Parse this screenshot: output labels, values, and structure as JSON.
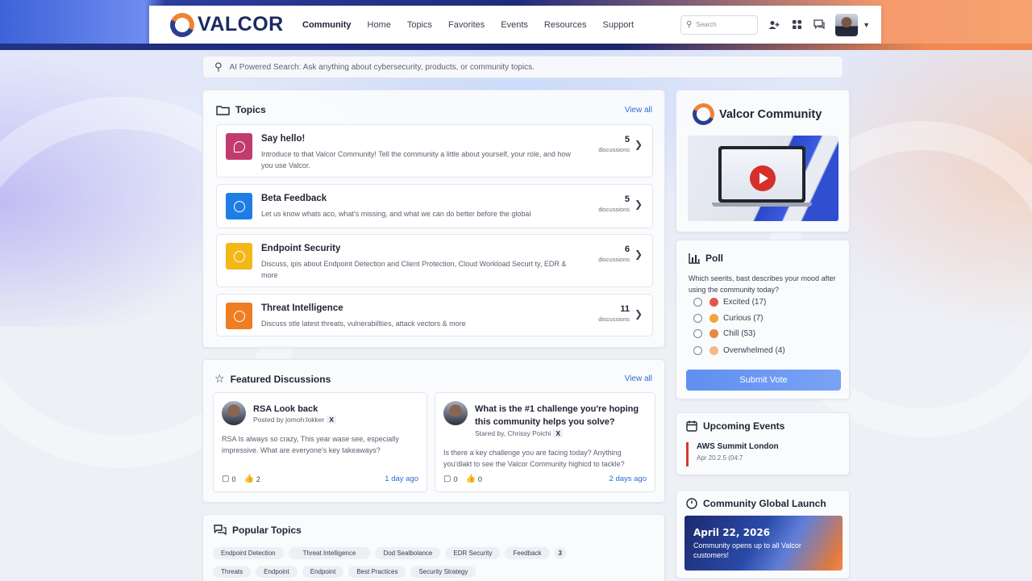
{
  "brand": {
    "name": "VALCOR"
  },
  "nav": {
    "links": [
      "Community",
      "Home",
      "Topics",
      "Favorites",
      "Events",
      "Resources",
      "Support"
    ],
    "active": "Community",
    "search_placeholder": "Search"
  },
  "ai_search": {
    "placeholder": "AI Powered Search: Ask anything about cybersecurity, products, or community topics."
  },
  "topics": {
    "title": "Topics",
    "view_all": "View all",
    "items": [
      {
        "title": "Say hello!",
        "desc": "Introduce to that Valcor Community! Tell the community a little about yourself, your role, and how you use Valcor.",
        "count": "5",
        "count_label": "discussions",
        "color": "#c23b6e"
      },
      {
        "title": "Beta Feedback",
        "desc": "Let us know whats aco, what's missing, and what we can do better before the global",
        "count": "5",
        "count_label": "discussions",
        "color": "#1f7ee6"
      },
      {
        "title": "Endpoint Security",
        "desc": "Discuss, ipis about Endpoint Detection and Client Protection, Cloud Workload Securt ty, EDR & more",
        "count": "6",
        "count_label": "discussions",
        "color": "#f4b71a"
      },
      {
        "title": "Threat Intelligence",
        "desc": "Discuss stle latest threats, vulnerabillties, attack vectors & more",
        "count": "11",
        "count_label": "discussions",
        "color": "#ef7d22"
      }
    ]
  },
  "featured": {
    "title": "Featured Discussions",
    "view_all": "View all",
    "items": [
      {
        "title": "RSA Look back",
        "by": "Posted by jomoh:lokker",
        "badge": "X",
        "text": "RSA Is always so crazy, This year wase see, especially impressive. What are everyone's key takeaways?",
        "comments": "0",
        "likes": "2",
        "ago": "1 day ago"
      },
      {
        "title": "What is the #1 challenge you're hoping this community helps you solve?",
        "by": "Stared by, Chrissy Poichi",
        "badge": "X",
        "text": "Is there a key challenge you are facing today? Anything you'dlakt to see the Valcor Community highicd to tackle?",
        "comments": "0",
        "likes": "0",
        "ago": "2 days ago"
      }
    ]
  },
  "popular": {
    "title": "Popular Topics",
    "row1": [
      "Endpoint Detection",
      "Threat Intelligence",
      "Dod Sealbolance",
      "EDR Security",
      "Feedback",
      "3"
    ],
    "row2": [
      "Threats",
      "Endpoint",
      "Endpoint",
      "Best Practices",
      "Security Strategy"
    ]
  },
  "community_card": {
    "title": "Valcor Community"
  },
  "poll": {
    "title": "Poll",
    "question": "Which seerits, bast describes your mood after using the community today?",
    "options": [
      {
        "label": "Excited",
        "count": "(17)",
        "color": "#e2574c"
      },
      {
        "label": "Curious",
        "count": "(7)",
        "color": "#f2a33a"
      },
      {
        "label": "Chill",
        "count": "(53)",
        "color": "#e8893b"
      },
      {
        "label": "Overwhelmed",
        "count": "(4)",
        "color": "#f5b88a"
      }
    ],
    "submit": "Submit Vote"
  },
  "events": {
    "title": "Upcoming Events",
    "items": [
      {
        "name": "AWS Summit London",
        "date": "Apr 20.2.5 (04:7"
      }
    ]
  },
  "launch": {
    "title": "Community Global Launch",
    "date": "April 22, 2026",
    "text": "Community opens up to all Valcor customers!"
  },
  "colors": {
    "accent": "#2e6bd6",
    "brand_orange": "#f08232",
    "brand_navy": "#1c2a63"
  }
}
